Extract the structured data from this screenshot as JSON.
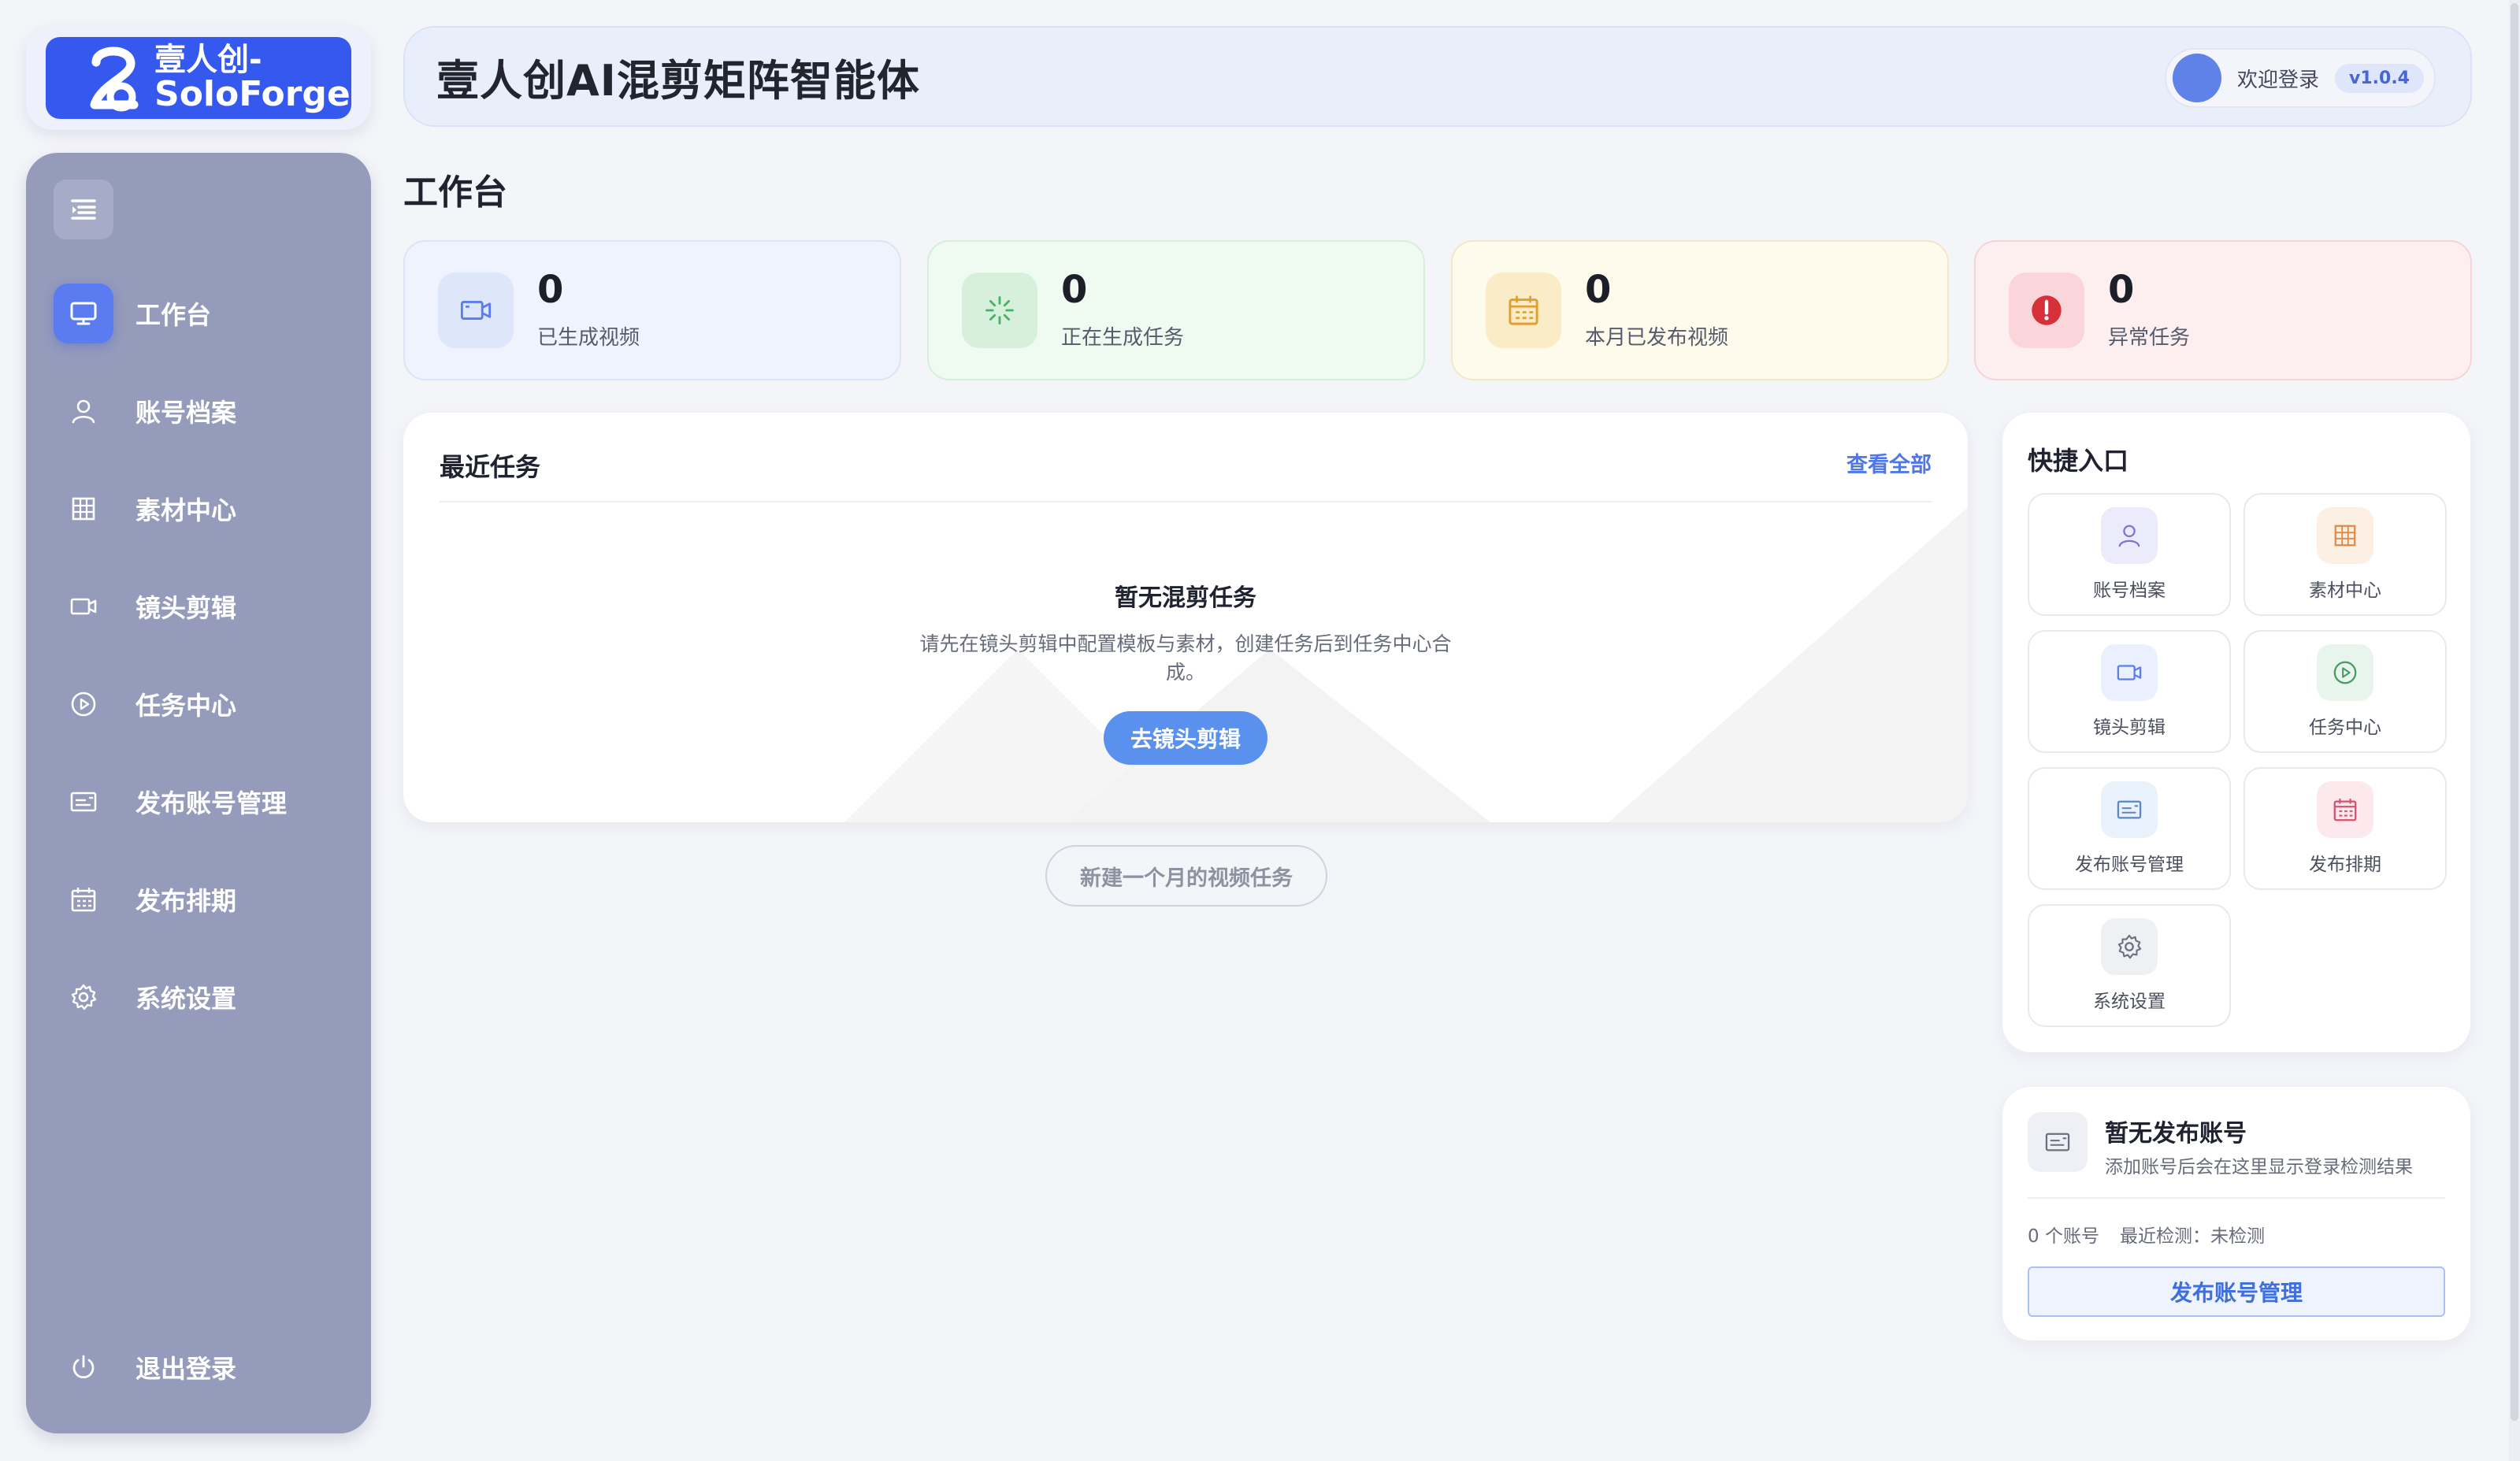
{
  "brand": {
    "line1": "壹人创-",
    "line2": "SoloForge",
    "color": "#3558ee"
  },
  "sidebar": {
    "collapse_icon": "menu-collapse-icon",
    "items": [
      {
        "label": "工作台",
        "icon": "monitor-icon",
        "active": true
      },
      {
        "label": "账号档案",
        "icon": "user-icon"
      },
      {
        "label": "素材中心",
        "icon": "grid-icon"
      },
      {
        "label": "镜头剪辑",
        "icon": "camera-icon"
      },
      {
        "label": "任务中心",
        "icon": "play-circle-icon"
      },
      {
        "label": "发布账号管理",
        "icon": "id-card-icon"
      },
      {
        "label": "发布排期",
        "icon": "calendar-icon"
      },
      {
        "label": "系统设置",
        "icon": "gear-icon"
      }
    ],
    "logout_label": "退出登录"
  },
  "header": {
    "title": "壹人创AI混剪矩阵智能体",
    "welcome": "欢迎登录",
    "version": "v1.0.4"
  },
  "page": {
    "title": "工作台"
  },
  "stats": [
    {
      "value": "0",
      "label": "已生成视频",
      "icon": "camera-icon",
      "color": "#5a7cf0"
    },
    {
      "value": "0",
      "label": "正在生成任务",
      "icon": "spinner-icon",
      "color": "#4caf6a"
    },
    {
      "value": "0",
      "label": "本月已发布视频",
      "icon": "calendar-icon",
      "color": "#e0a030"
    },
    {
      "value": "0",
      "label": "异常任务",
      "icon": "alert-icon",
      "color": "#d6303a"
    }
  ],
  "recent": {
    "title": "最近任务",
    "view_all": "查看全部",
    "empty_title": "暂无混剪任务",
    "empty_desc": "请先在镜头剪辑中配置模板与素材，创建任务后到任务中心合成。",
    "go_button": "去镜头剪辑",
    "new_month_button": "新建一个月的视频任务"
  },
  "quick": {
    "title": "快捷入口",
    "items": [
      {
        "label": "账号档案",
        "icon": "user-icon"
      },
      {
        "label": "素材中心",
        "icon": "grid-icon"
      },
      {
        "label": "镜头剪辑",
        "icon": "camera-icon"
      },
      {
        "label": "任务中心",
        "icon": "play-circle-icon"
      },
      {
        "label": "发布账号管理",
        "icon": "id-card-icon"
      },
      {
        "label": "发布排期",
        "icon": "calendar-icon"
      },
      {
        "label": "系统设置",
        "icon": "gear-icon"
      }
    ]
  },
  "account": {
    "title": "暂无发布账号",
    "desc": "添加账号后会在这里显示登录检测结果",
    "count": "0 个账号",
    "last_check": "最近检测：未检测",
    "button": "发布账号管理"
  }
}
